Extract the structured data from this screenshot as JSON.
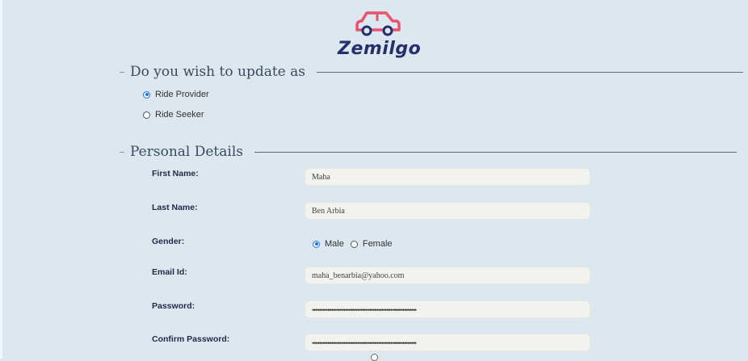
{
  "brand": {
    "name": "Zemilgo",
    "icon": "car-icon",
    "accent": "#e8546f",
    "text_color": "#23306b"
  },
  "role_section": {
    "legend": "Do you wish to update as",
    "options": [
      {
        "label": "Ride Provider",
        "checked": true
      },
      {
        "label": "Ride Seeker",
        "checked": false
      }
    ]
  },
  "personal_section": {
    "legend": "Personal Details",
    "first_name": {
      "label": "First Name:",
      "value": "Maha"
    },
    "last_name": {
      "label": "Last Name:",
      "value": "Ben Arbia"
    },
    "gender": {
      "label": "Gender:",
      "options": [
        {
          "label": "Male",
          "checked": true
        },
        {
          "label": "Female",
          "checked": false
        }
      ]
    },
    "email": {
      "label": "Email Id:",
      "value": "maha_benarbia@yahoo.com"
    },
    "password": {
      "label": "Password:",
      "value": "••••••••••••••••••••••••••••••••••••••••••••••••••••••••••••"
    },
    "confirm_password": {
      "label": "Confirm Password:",
      "value": "••••••••••••••••••••••••••••••••••••••••••••••••••••••••••••"
    }
  }
}
